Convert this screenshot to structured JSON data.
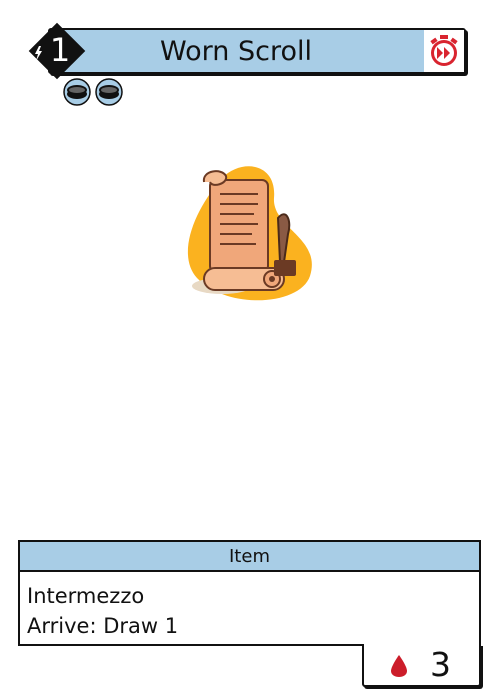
{
  "card": {
    "name": "Worn Scroll",
    "cost": "1",
    "type": "Item",
    "ability_lines": [
      "Intermezzo",
      "Arrive: Draw 1"
    ],
    "life": "3"
  },
  "icons": {
    "cost": "lightning-diamond-icon",
    "speed": "fast-forward-stopwatch-icon",
    "tokens": [
      "coin-icon",
      "coin-icon"
    ],
    "art": "scroll-with-quill-illustration",
    "life": "blood-drop-icon"
  },
  "colors": {
    "title_bar": "#a8cde6",
    "type_strip": "#a8cde6",
    "speed_red": "#d9242f",
    "blood_red": "#cc1d2a",
    "art_backdrop": "#fbb21f"
  }
}
